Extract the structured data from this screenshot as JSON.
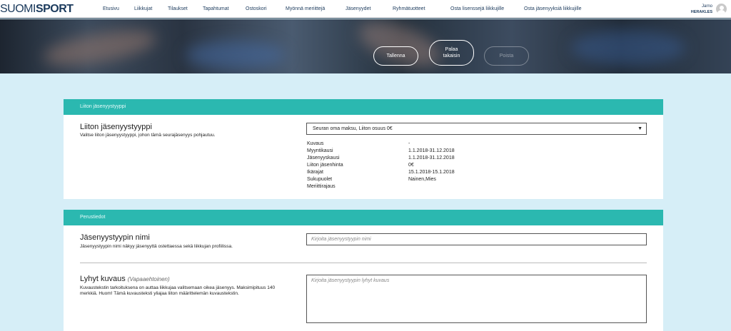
{
  "header": {
    "logo_thin": "SUOMI",
    "logo_bold": "SPORT",
    "nav": [
      "Etusivu",
      "Liikkujat",
      "Tilaukset",
      "Tapahtumat",
      "Ostoskori",
      "Myönnä meriittejä",
      "Jäsenyydet",
      "Ryhmätuotteet",
      "Osta lisenssejä liikkujille",
      "Osta jäsenyyksiä liikkujille"
    ],
    "user_name": "Jarno",
    "user_club": "HERAKLES"
  },
  "hero": {
    "save_label": "Tallenna",
    "back_label": "Palaa takaisin",
    "delete_label": "Poista"
  },
  "section1": {
    "header": "Liiton jäsenyystyyppi",
    "label": "Liiton jäsenyystyyppi",
    "description": "Valitse liiton jäsenyystyyppi, johon tämä seurajäsenyys pohjautuu.",
    "selected": "Seuran oma maksu, Liiton osuus 0€",
    "details": [
      {
        "key": "Kuvaus",
        "value": "-"
      },
      {
        "key": "Myyntikausi",
        "value": "1.1.2018-31.12.2018"
      },
      {
        "key": "Jäsenyyskausi",
        "value": "1.1.2018-31.12.2018"
      },
      {
        "key": "Liiton jäsenhinta",
        "value": "0€"
      },
      {
        "key": "Ikärajat",
        "value": "15.1.2018-15.1.2018"
      },
      {
        "key": "Sukupuolet",
        "value": "Nainen,Mies"
      },
      {
        "key": "Meriittirajaus",
        "value": ""
      }
    ]
  },
  "section2": {
    "header": "Perustiedot",
    "name_label": "Jäsenyystyypin nimi",
    "name_desc": "Jäsenyystyypin nimi näkyy jäsenyyttä ostettaessa sekä liikkujan profiilissa.",
    "name_placeholder": "Kirjoita jäsenyystyypin nimi",
    "short_label": "Lyhyt kuvaus",
    "short_optional": "(Vapaaehtoinen)",
    "short_desc": "Kuvaustekstin tarkoituksena on auttaa liikkujaa valitsemaan oikea jäsenyys. Maksimipituus 140 merkkiä. Huom! Tämä kuvausteksti yliajaa liiton määrittelemän kuvaustekstin.",
    "short_placeholder": "Kirjoita jäsenyystyypin lyhyt kuvaus"
  }
}
